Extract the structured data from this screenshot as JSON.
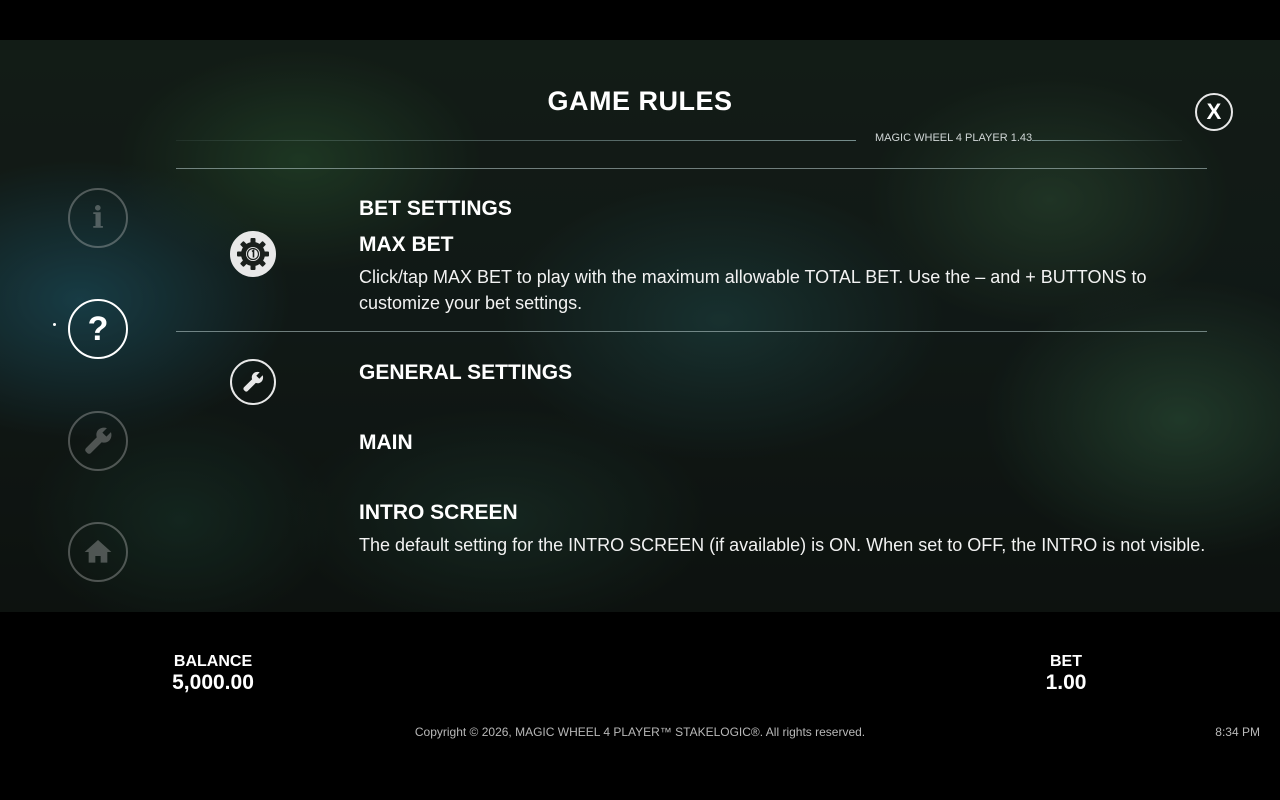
{
  "header": {
    "title": "GAME RULES",
    "version": "MAGIC WHEEL 4 PLAYER 1.43",
    "close_label": "X"
  },
  "nav": {
    "items": [
      {
        "name": "info",
        "icon": "info-icon",
        "glyph": "i",
        "active": false
      },
      {
        "name": "rules",
        "icon": "question-icon",
        "glyph": "?",
        "active": true
      },
      {
        "name": "settings",
        "icon": "wrench-icon",
        "active": false
      },
      {
        "name": "home",
        "icon": "home-icon",
        "active": false
      }
    ]
  },
  "sections": {
    "bet_settings": {
      "icon": "gear-icon",
      "title": "BET SETTINGS",
      "subtitle": "MAX BET",
      "text": "Click/tap MAX BET to play with the maximum allowable TOTAL BET. Use the – and + BUTTONS to customize your bet settings."
    },
    "general_settings": {
      "icon": "wrench-icon",
      "title": "GENERAL SETTINGS",
      "main": "MAIN",
      "intro_title": "INTRO SCREEN",
      "intro_text": "The default setting for the INTRO SCREEN (if available) is ON. When set to OFF, the INTRO is not visible."
    }
  },
  "footer": {
    "balance_label": "BALANCE",
    "balance_value": "5,000.00",
    "bet_label": "BET",
    "bet_value": "1.00",
    "copyright": "Copyright © 2026, MAGIC WHEEL 4 PLAYER™ STAKELOGIC®. All rights reserved.",
    "clock": "8:34 PM"
  },
  "colors": {
    "text": "#ffffff",
    "muted_icon": "#c8c8c8",
    "background": "#000000"
  }
}
